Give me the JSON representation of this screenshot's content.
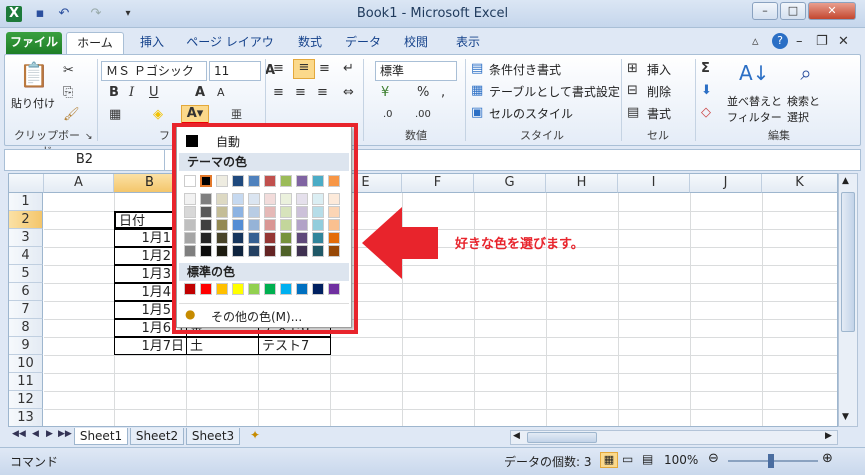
{
  "window": {
    "title": "Book1 - Microsoft Excel",
    "qat": [
      "excel-logo-icon",
      "save-icon",
      "undo-icon",
      "redo-icon",
      "customize-qat-icon"
    ]
  },
  "tabs": [
    {
      "label": "ファイル",
      "name": "tab-file"
    },
    {
      "label": "ホーム",
      "name": "tab-home"
    },
    {
      "label": "挿入",
      "name": "tab-insert"
    },
    {
      "label": "ページ レイアウト",
      "name": "tab-page-layout"
    },
    {
      "label": "数式",
      "name": "tab-formulas"
    },
    {
      "label": "データ",
      "name": "tab-data"
    },
    {
      "label": "校閲",
      "name": "tab-review"
    },
    {
      "label": "表示",
      "name": "tab-view"
    }
  ],
  "ribbon": {
    "clipboard": {
      "paste": "貼り付け",
      "label": "クリップボード"
    },
    "font": {
      "name": "ＭＳ Ｐゴシック",
      "size": "11",
      "label": "フォント"
    },
    "alignment": {
      "label": "配置"
    },
    "number": {
      "format": "標準",
      "label": "数値"
    },
    "styles": {
      "conditional": "条件付き書式",
      "table": "テーブルとして書式設定",
      "cell": "セルのスタイル",
      "label": "スタイル"
    },
    "cells": {
      "insert": "挿入",
      "delete": "削除",
      "format": "書式",
      "label": "セル"
    },
    "editing": {
      "sort": "並べ替えと",
      "sort2": "フィルター",
      "find": "検索と",
      "find2": "選択",
      "label": "編集"
    }
  },
  "formula_bar": {
    "name_box": "B2",
    "content": ""
  },
  "columns": [
    "A",
    "B",
    "C",
    "D",
    "E",
    "F",
    "G",
    "H",
    "I",
    "J",
    "K"
  ],
  "rows": [
    "1",
    "2",
    "3",
    "4",
    "5",
    "6",
    "7",
    "8",
    "9",
    "10",
    "11",
    "12",
    "13"
  ],
  "cells": {
    "b2": "日付",
    "b3": "1月1日",
    "b4": "1月2日",
    "b5": "1月3日",
    "b6": "1月4日",
    "b7": "1月5日",
    "b8": "1月6日",
    "b9": "1月7日",
    "c8": "金",
    "c9": "土",
    "d8": "テスト6",
    "d9": "テスト7"
  },
  "palette": {
    "auto": "自動",
    "theme_header": "テーマの色",
    "standard_header": "標準の色",
    "more": "その他の色(M)...",
    "theme_top": [
      "#ffffff",
      "#000000",
      "#eeece1",
      "#1f497d",
      "#4f81bd",
      "#c0504d",
      "#9bbb59",
      "#8064a2",
      "#4bacc6",
      "#f79646"
    ],
    "theme_shades": [
      [
        "#f2f2f2",
        "#7f7f7f",
        "#ddd9c3",
        "#c6d9f0",
        "#dbe5f1",
        "#f2dcdb",
        "#ebf1dd",
        "#e5e0ec",
        "#dbeef3",
        "#fdeada"
      ],
      [
        "#d8d8d8",
        "#595959",
        "#c4bd97",
        "#8db3e2",
        "#b8cce4",
        "#e5b9b7",
        "#d7e3bc",
        "#ccc1d9",
        "#b7dde8",
        "#fbd5b5"
      ],
      [
        "#bfbfbf",
        "#3f3f3f",
        "#938953",
        "#548dd4",
        "#95b3d7",
        "#d99694",
        "#c3d69b",
        "#b2a2c7",
        "#92cddc",
        "#fac08f"
      ],
      [
        "#a5a5a5",
        "#262626",
        "#494429",
        "#17365d",
        "#366092",
        "#953734",
        "#76923c",
        "#5f497a",
        "#31859b",
        "#e36c09"
      ],
      [
        "#7f7f7f",
        "#0c0c0c",
        "#1d1b10",
        "#0f243e",
        "#244061",
        "#632423",
        "#4f6128",
        "#3f3151",
        "#205867",
        "#974806"
      ]
    ],
    "standard": [
      "#c00000",
      "#ff0000",
      "#ffc000",
      "#ffff00",
      "#92d050",
      "#00b050",
      "#00b0f0",
      "#0070c0",
      "#002060",
      "#7030a0"
    ]
  },
  "annotation": {
    "text": "好きな色を選びます。",
    "color": "#e8242c"
  },
  "sheets": [
    "Sheet1",
    "Sheet2",
    "Sheet3"
  ],
  "status": {
    "mode": "コマンド",
    "count": "データの個数: 3",
    "zoom": "100%"
  }
}
